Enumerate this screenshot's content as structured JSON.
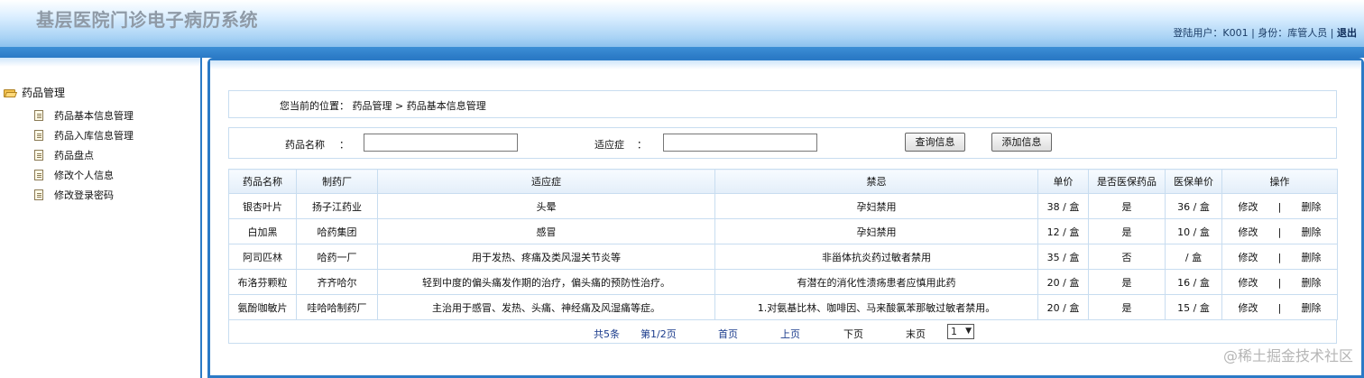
{
  "app": {
    "title": "基层医院门诊电子病历系统"
  },
  "user_info": {
    "text": "登陆用户：K001 | 身份：库管人员 |",
    "logout": "退出"
  },
  "sidebar": {
    "root": "药品管理",
    "items": [
      {
        "label": "药品基本信息管理"
      },
      {
        "label": "药品入库信息管理"
      },
      {
        "label": "药品盘点"
      },
      {
        "label": "修改个人信息"
      },
      {
        "label": "修改登录密码"
      }
    ]
  },
  "breadcrumb": {
    "text": "您当前的位置：  药品管理 > 药品基本信息管理"
  },
  "search": {
    "name_label": "药品名称",
    "name_colon": "：",
    "indication_label": "适应症",
    "indication_colon": "：",
    "name_value": "",
    "indication_value": "",
    "query_button": "查询信息",
    "add_button": "添加信息"
  },
  "table": {
    "headers": [
      "药品名称",
      "制药厂",
      "适应症",
      "禁忌",
      "单价",
      "是否医保药品",
      "医保单价",
      "操作"
    ],
    "rows": [
      {
        "name": "银杏叶片",
        "maker": "扬子江药业",
        "indication": "头晕",
        "taboo": "孕妇禁用",
        "price": "38 / 盒",
        "insured": "是",
        "ins_price": "36 / 盒",
        "edit": "修改",
        "sep": "|",
        "del": "删除"
      },
      {
        "name": "白加黑",
        "maker": "哈药集团",
        "indication": "感冒",
        "taboo": "孕妇禁用",
        "price": "12 / 盒",
        "insured": "是",
        "ins_price": "10 / 盒",
        "edit": "修改",
        "sep": "|",
        "del": "删除"
      },
      {
        "name": "阿司匹林",
        "maker": "哈药一厂",
        "indication": "用于发热、疼痛及类风湿关节炎等",
        "taboo": "非甾体抗炎药过敏者禁用",
        "price": "35 / 盒",
        "insured": "否",
        "ins_price": "/ 盒",
        "edit": "修改",
        "sep": "|",
        "del": "删除"
      },
      {
        "name": "布洛芬颗粒",
        "maker": "齐齐哈尔",
        "indication": "轻到中度的偏头痛发作期的治疗，偏头痛的预防性治疗。",
        "taboo": "有潜在的消化性溃疡患者应慎用此药",
        "price": "20 / 盒",
        "insured": "是",
        "ins_price": "16 / 盒",
        "edit": "修改",
        "sep": "|",
        "del": "删除"
      },
      {
        "name": "氨酚咖敏片",
        "maker": "哇哈哈制药厂",
        "indication": "主治用于感冒、发热、头痛、神经痛及风湿痛等症。",
        "taboo": "1.对氨基比林、咖啡因、马来酸氯苯那敏过敏者禁用。",
        "price": "20 / 盒",
        "insured": "是",
        "ins_price": "15 / 盒",
        "edit": "修改",
        "sep": "|",
        "del": "删除"
      }
    ]
  },
  "pager": {
    "total": "共5条",
    "page": "第1/2页",
    "first": "首页",
    "prev": "上页",
    "next": "下页",
    "last": "末页",
    "select_value": "1"
  },
  "watermark": "@稀土掘金技术社区"
}
